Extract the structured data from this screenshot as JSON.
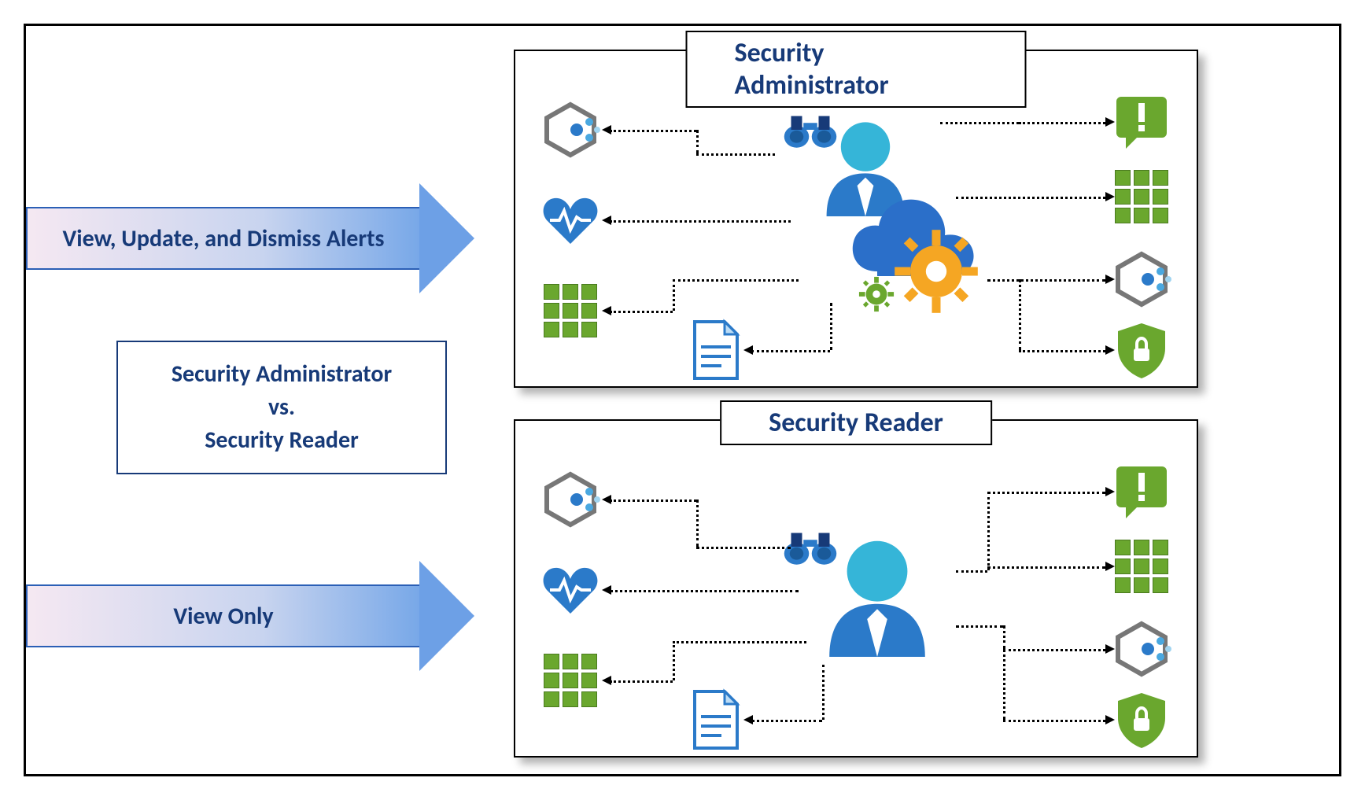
{
  "arrows": {
    "top_label": "View, Update, and Dismiss Alerts",
    "bottom_label": "View Only"
  },
  "center_box": {
    "line1": "Security Administrator",
    "line2": "vs.",
    "line3": "Security Reader"
  },
  "panels": {
    "admin_title": "Security Administrator",
    "reader_title": "Security Reader"
  },
  "icons": {
    "hexagon": "hexagon-nodes-icon",
    "heart": "health-heart-icon",
    "grid": "app-grid-icon",
    "document": "document-icon",
    "alert": "alert-icon",
    "shield": "shield-lock-icon",
    "user": "user-icon",
    "binoculars": "binoculars-icon",
    "cloud": "cloud-icon",
    "gear": "gear-settings-icon"
  },
  "colors": {
    "navy": "#173a78",
    "blue": "#2b7ac9",
    "green": "#6aa72e",
    "orange": "#f5a623"
  }
}
